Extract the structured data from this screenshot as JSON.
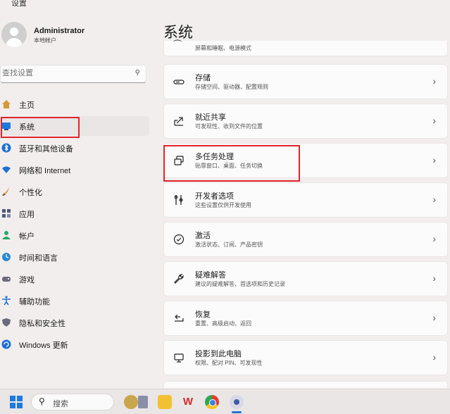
{
  "window": {
    "title": "设置"
  },
  "user": {
    "name": "Administrator",
    "account_type": "本地帐户"
  },
  "search": {
    "placeholder": "查找设置"
  },
  "nav": [
    {
      "label": "主页",
      "icon": "home-icon",
      "color": "#d49a3a"
    },
    {
      "label": "系统",
      "icon": "monitor-icon",
      "color": "#1f7ae0",
      "active": true
    },
    {
      "label": "蓝牙和其他设备",
      "icon": "bluetooth-icon",
      "color": "#1f6fd6"
    },
    {
      "label": "网络和 Internet",
      "icon": "wifi-icon",
      "color": "#1f6fd6"
    },
    {
      "label": "个性化",
      "icon": "brush-icon",
      "color": "#e08a2a"
    },
    {
      "label": "应用",
      "icon": "apps-icon",
      "color": "#4a5a7a"
    },
    {
      "label": "帐户",
      "icon": "person-icon",
      "color": "#2aa86a"
    },
    {
      "label": "时间和语言",
      "icon": "clock-globe-icon",
      "color": "#2a8ad6"
    },
    {
      "label": "游戏",
      "icon": "gamepad-icon",
      "color": "#6a6a7a"
    },
    {
      "label": "辅助功能",
      "icon": "accessibility-icon",
      "color": "#1f6fd6"
    },
    {
      "label": "隐私和安全性",
      "icon": "shield-icon",
      "color": "#6a6a7a"
    },
    {
      "label": "Windows 更新",
      "icon": "update-icon",
      "color": "#1f6fd6"
    }
  ],
  "page": {
    "title": "系统"
  },
  "partial_card": {
    "subtitle": "屏幕和睡眠、电源模式",
    "icon": "power-icon"
  },
  "cards": [
    {
      "title": "存储",
      "subtitle": "存储空间、驱动器、配置规则",
      "icon": "storage-icon"
    },
    {
      "title": "就近共享",
      "subtitle": "可发现性、收到文件的位置",
      "icon": "share-icon"
    },
    {
      "title": "多任务处理",
      "subtitle": "贴靠窗口、桌面、任务切换",
      "icon": "multitasking-icon"
    },
    {
      "title": "开发者选项",
      "subtitle": "这些设置仅供开发使用",
      "icon": "developer-tools-icon"
    },
    {
      "title": "激活",
      "subtitle": "激活状态、订阅、产品密钥",
      "icon": "activation-check-icon"
    },
    {
      "title": "疑难解答",
      "subtitle": "建议的疑难解答、首选项和历史记录",
      "icon": "wrench-icon"
    },
    {
      "title": "恢复",
      "subtitle": "重置、高级启动、返回",
      "icon": "recovery-icon"
    },
    {
      "title": "投影到此电脑",
      "subtitle": "权限、配对 PIN、可发现性",
      "icon": "projection-icon"
    }
  ],
  "taskbar": {
    "search_label": "搜索",
    "apps": [
      "windows-start-icon",
      "widgets-icon",
      "file-explorer-icon",
      "wps-office-icon",
      "chrome-icon",
      "settings-icon"
    ]
  },
  "colors": {
    "accent": "#1f7ae0",
    "highlight_box": "#e0252b"
  }
}
